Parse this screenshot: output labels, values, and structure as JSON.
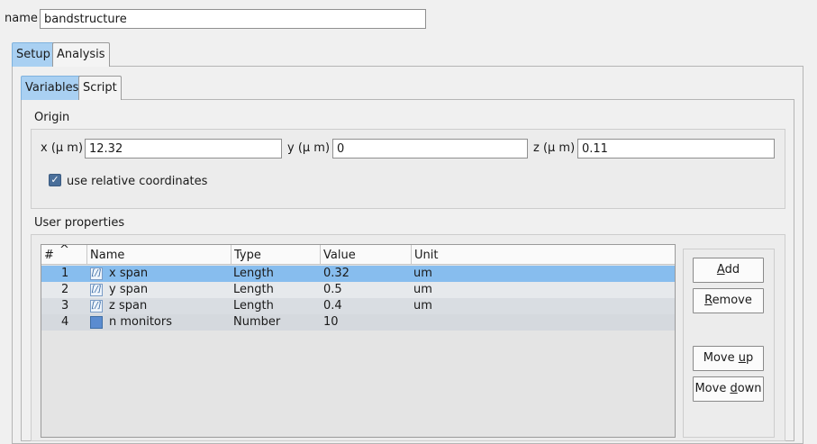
{
  "name_field": {
    "label": "name",
    "value": "bandstructure"
  },
  "outer_tabs": [
    {
      "label": "Setup",
      "active": true
    },
    {
      "label": "Analysis",
      "active": false
    }
  ],
  "inner_tabs": [
    {
      "label": "Variables",
      "active": true
    },
    {
      "label": "Script",
      "active": false
    }
  ],
  "origin": {
    "title": "Origin",
    "x": {
      "label": "x (μ m)",
      "value": "12.32"
    },
    "y": {
      "label": "y (μ m)",
      "value": "0"
    },
    "z": {
      "label": "z (μ m)",
      "value": "0.11"
    },
    "relative_checkbox": {
      "label": "use relative coordinates",
      "checked": true,
      "check_glyph": "✓"
    }
  },
  "user_properties": {
    "title": "User properties",
    "columns": {
      "index": "#",
      "sort_glyph": "^",
      "name": "Name",
      "type": "Type",
      "value": "Value",
      "unit": "Unit"
    },
    "rows": [
      {
        "index": "1",
        "icon": "[/]",
        "name": "x span",
        "type": "Length",
        "value": "0.32",
        "unit": "um",
        "selected": true
      },
      {
        "index": "2",
        "icon": "[/]",
        "name": "y span",
        "type": "Length",
        "value": "0.5",
        "unit": "um",
        "selected": false
      },
      {
        "index": "3",
        "icon": "[/]",
        "name": "z span",
        "type": "Length",
        "value": "0.4",
        "unit": "um",
        "selected": false
      },
      {
        "index": "4",
        "icon": "▪",
        "name": "n monitors",
        "type": "Number",
        "value": "10",
        "unit": "",
        "selected": false
      }
    ]
  },
  "buttons": {
    "add": {
      "pre": "",
      "key": "A",
      "post": "dd"
    },
    "remove": {
      "pre": "",
      "key": "R",
      "post": "emove"
    },
    "move_up": {
      "pre": "Move ",
      "key": "u",
      "post": "p"
    },
    "move_down": {
      "pre": "Move ",
      "key": "d",
      "post": "own"
    }
  },
  "colors": {
    "active_tab": "#a9d0f2",
    "selected_row": "#87bdee",
    "checkbox": "#4a6f9a"
  }
}
